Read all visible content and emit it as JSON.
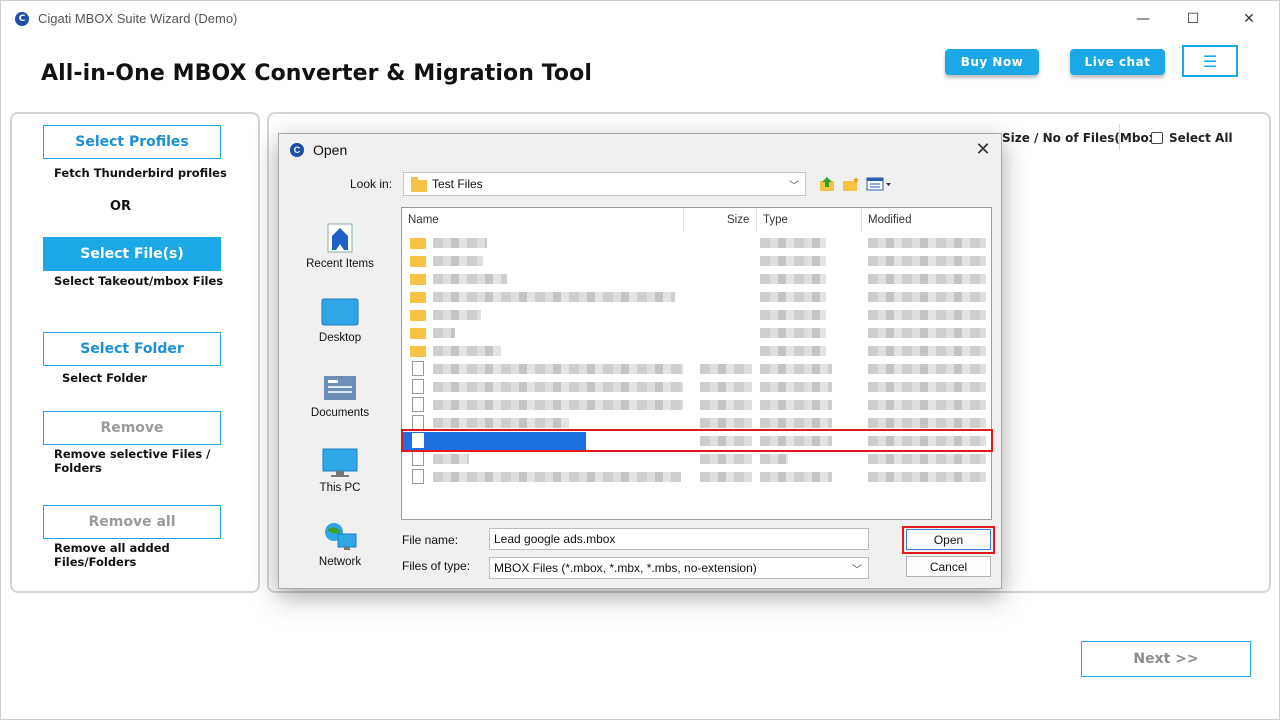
{
  "window": {
    "title": "Cigati MBOX Suite Wizard (Demo)",
    "icon_glyph": "C"
  },
  "controls": {
    "minimize": "—",
    "maximize": "☐",
    "close": "✕"
  },
  "header": {
    "title": "All-in-One MBOX Converter & Migration Tool",
    "buy_now": "Buy Now",
    "live_chat": "Live chat",
    "menu_glyph": "☰"
  },
  "sidebar": {
    "select_profiles": "Select Profiles",
    "select_profiles_desc": "Fetch Thunderbird profiles",
    "or": "OR",
    "select_files": "Select File(s)",
    "select_files_desc": "Select Takeout/mbox Files",
    "select_folder": "Select Folder",
    "select_folder_desc": "Select Folder",
    "remove": "Remove",
    "remove_desc": "Remove selective Files / Folders",
    "remove_all": "Remove all",
    "remove_all_desc": "Remove all added Files/Folders"
  },
  "table": {
    "size_col": "Size / No of Files(Mbox)",
    "select_all": "Select All"
  },
  "next_button": "Next >>",
  "dialog": {
    "title": "Open",
    "look_in_label": "Look in:",
    "look_in_value": "Test Files",
    "places": [
      "Recent Items",
      "Desktop",
      "Documents",
      "This PC",
      "Network"
    ],
    "columns": {
      "name": "Name",
      "size": "Size",
      "type": "Type",
      "modified": "Modified"
    },
    "file_name_label": "File name:",
    "file_name_value": "Lead google ads.mbox",
    "files_of_type_label": "Files of type:",
    "files_of_type_value": "MBOX Files (*.mbox, *.mbx, *.mbs, no-extension)",
    "open_button": "Open",
    "cancel_button": "Cancel"
  },
  "colors": {
    "accent": "#1aa8e6",
    "highlight_red": "#e0191f",
    "selection_blue": "#1e6fe0"
  }
}
